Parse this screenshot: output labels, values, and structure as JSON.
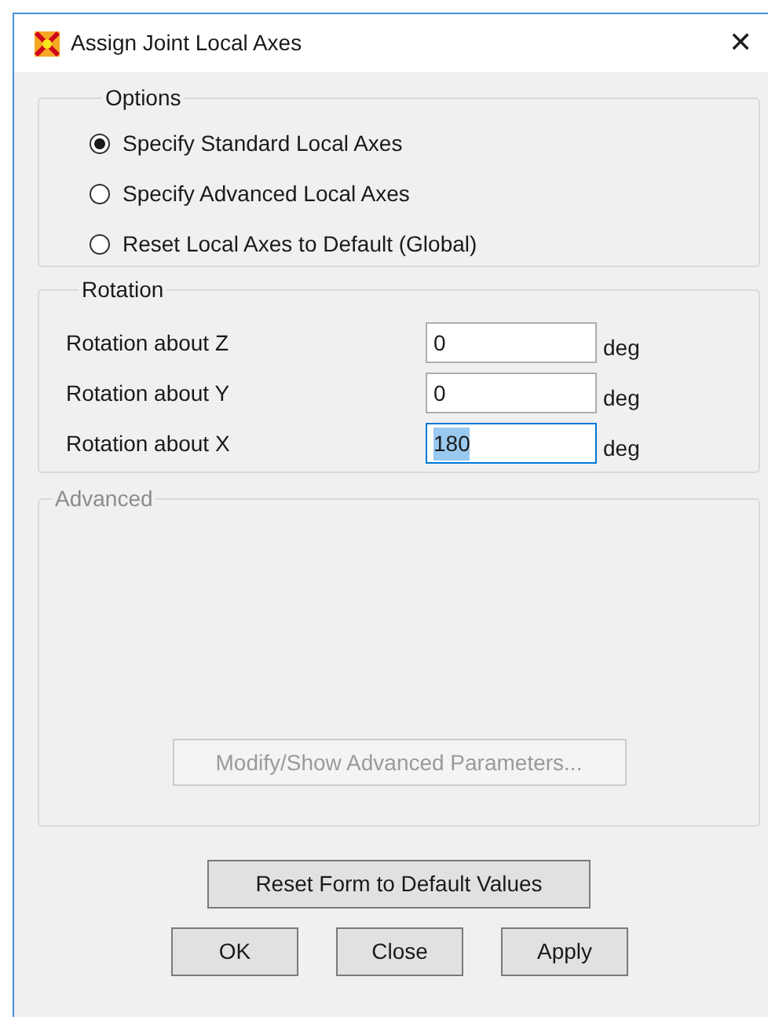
{
  "window": {
    "title": "Assign Joint Local Axes",
    "close": "✕"
  },
  "options": {
    "title": "Options",
    "items": [
      {
        "label": "Specify Standard Local Axes",
        "selected": true
      },
      {
        "label": "Specify Advanced Local Axes",
        "selected": false
      },
      {
        "label": "Reset Local Axes to Default  (Global)",
        "selected": false
      }
    ]
  },
  "rotation": {
    "title": "Rotation",
    "rows": [
      {
        "label": "Rotation about Z",
        "value": "0",
        "unit": "deg",
        "focused": false
      },
      {
        "label": "Rotation about Y",
        "value": "0",
        "unit": "deg",
        "focused": false
      },
      {
        "label": "Rotation about X",
        "value": "180",
        "unit": "deg",
        "focused": true
      }
    ]
  },
  "advanced": {
    "title": "Advanced",
    "disabled": true,
    "button": "Modify/Show Advanced Parameters..."
  },
  "reset_button": "Reset Form to Default Values",
  "buttons": [
    "OK",
    "Close",
    "Apply"
  ]
}
